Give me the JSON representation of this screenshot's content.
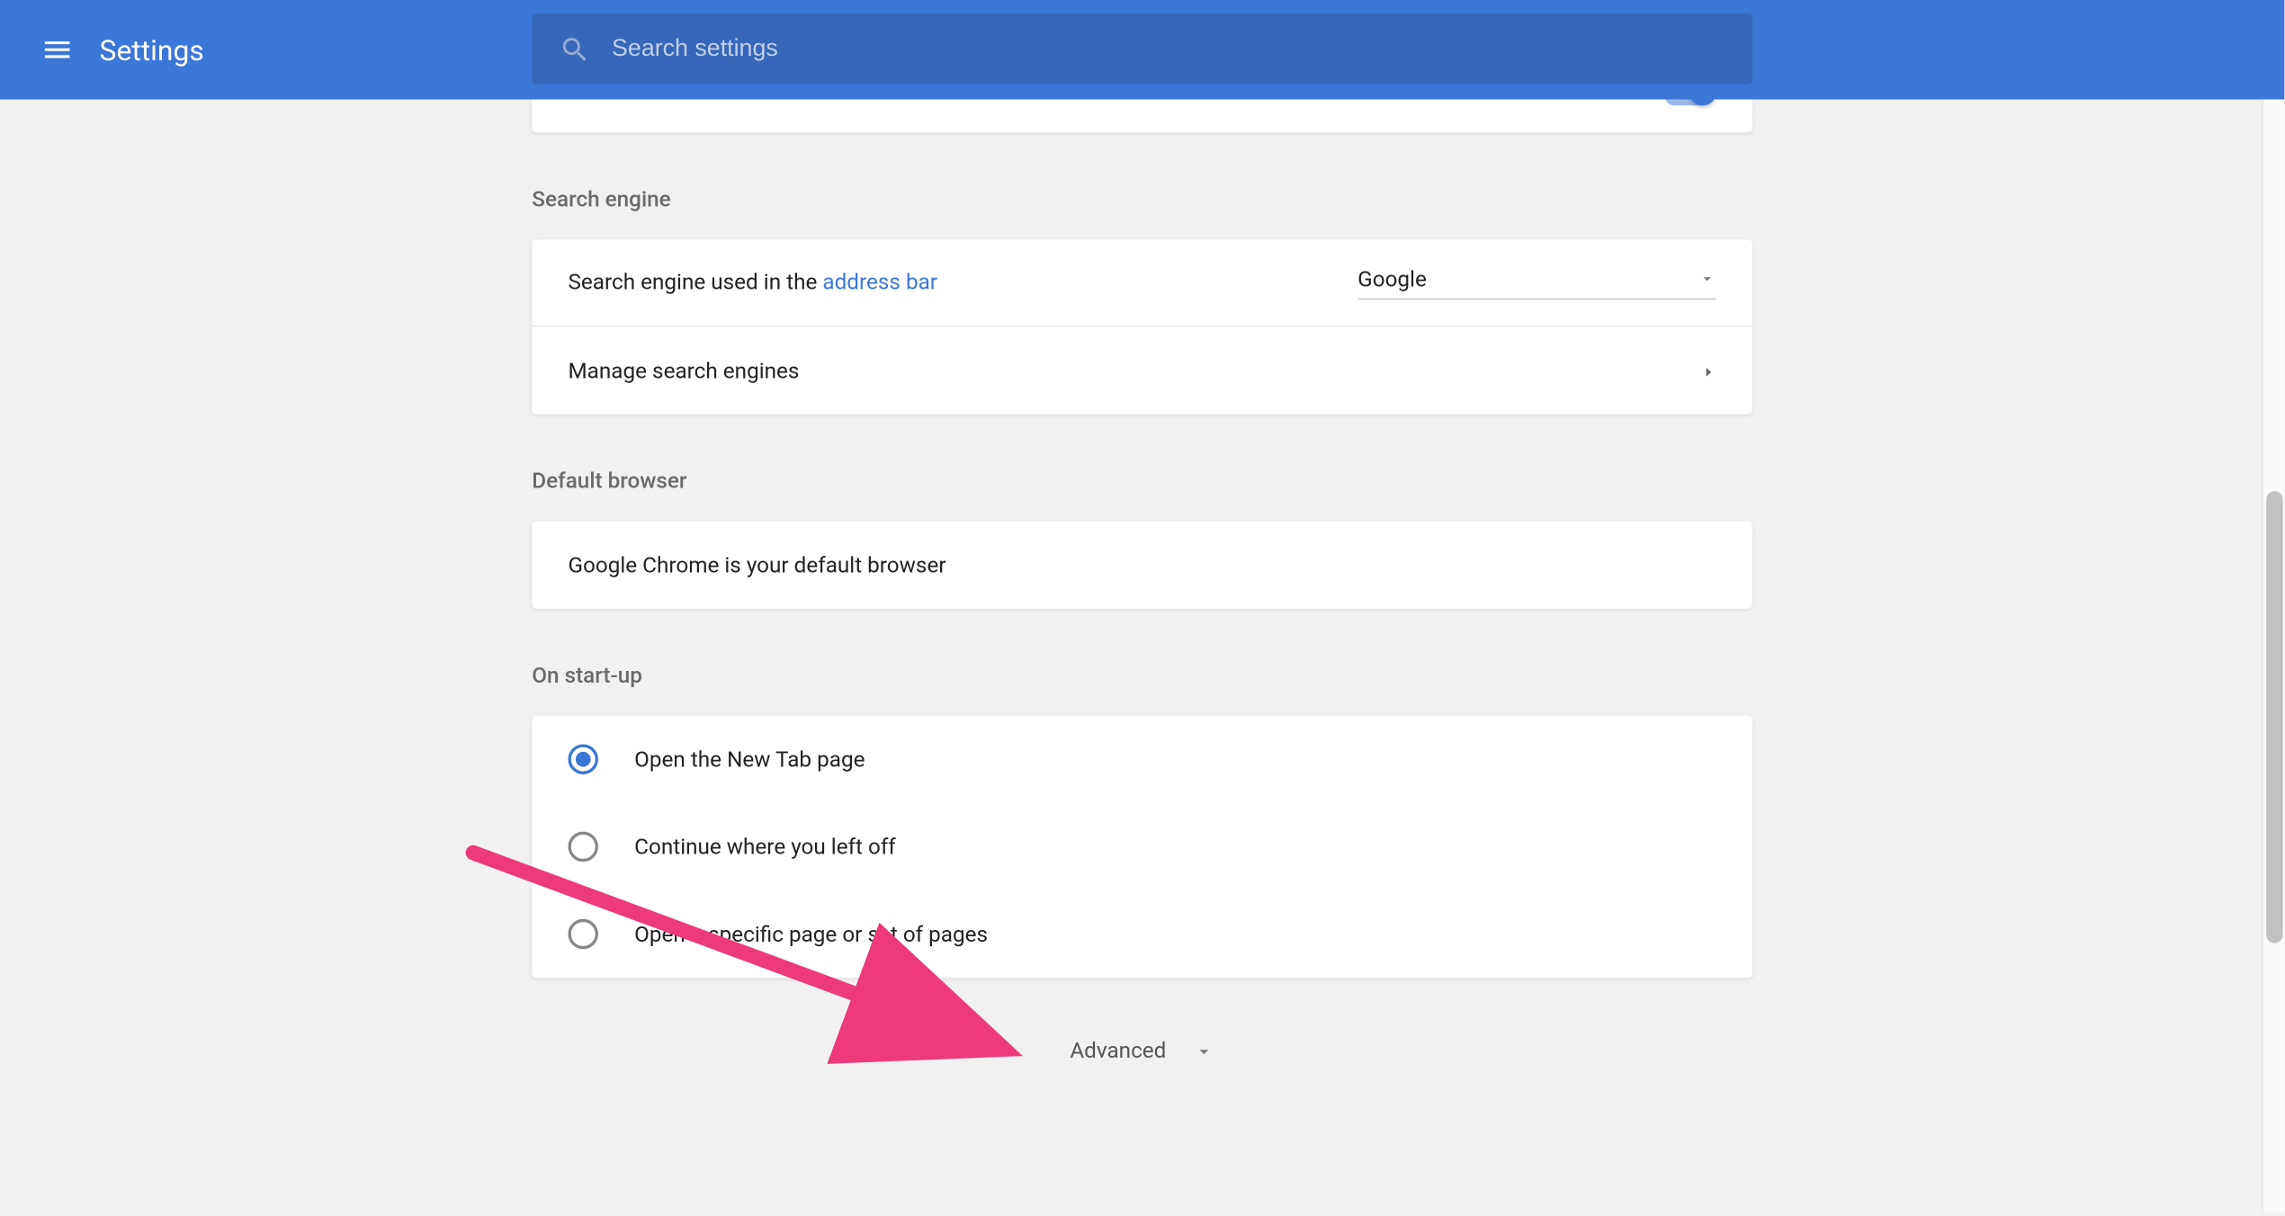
{
  "header": {
    "title": "Settings",
    "search_placeholder": "Search settings"
  },
  "sections": {
    "search_engine": {
      "heading": "Search engine",
      "row1_prefix": "Search engine used in the ",
      "row1_link": "address bar",
      "dropdown_value": "Google",
      "row2_label": "Manage search engines"
    },
    "default_browser": {
      "heading": "Default browser",
      "message": "Google Chrome is your default browser"
    },
    "on_startup": {
      "heading": "On start-up",
      "options": [
        "Open the New Tab page",
        "Continue where you left off",
        "Open a specific page or set of pages"
      ],
      "selected_index": 0
    }
  },
  "advanced_label": "Advanced"
}
